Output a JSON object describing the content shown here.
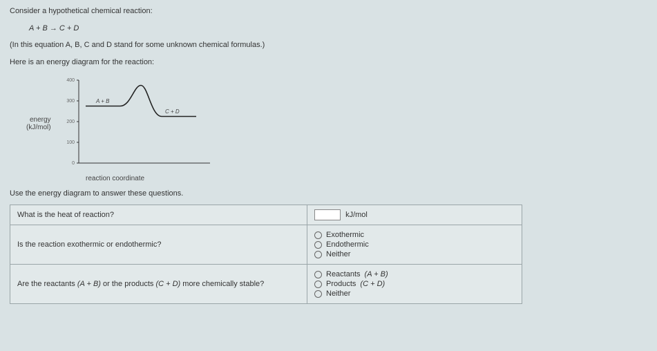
{
  "intro": {
    "line1": "Consider a hypothetical chemical reaction:",
    "equation": "A + B → C + D",
    "line2": "(In this equation A, B, C and D stand for some unknown chemical formulas.)",
    "line3": "Here is an energy diagram for the reaction:"
  },
  "chart_data": {
    "type": "line",
    "xlabel": "reaction coordinate",
    "ylabel_top": "energy",
    "ylabel_bottom": "(kJ/mol)",
    "y_ticks": [
      0,
      100,
      200,
      300,
      400
    ],
    "reactant_label": "A + B",
    "product_label": "C + D",
    "reactant_energy": 275,
    "peak_energy": 375,
    "product_energy": 225,
    "ylim": [
      0,
      400
    ]
  },
  "use_line": "Use the energy diagram to answer these questions.",
  "questions": {
    "q1": {
      "text": "What is the heat of reaction?",
      "unit": "kJ/mol"
    },
    "q2": {
      "text": "Is the reaction exothermic or endothermic?",
      "options": [
        "Exothermic",
        "Endothermic",
        "Neither"
      ]
    },
    "q3": {
      "text_pre": "Are the reactants ",
      "text_reactants": "(A + B)",
      "text_mid": " or the products ",
      "text_products": "(C + D)",
      "text_post": " more chemically stable?",
      "opt1_pre": "Reactants ",
      "opt1_expr": "(A + B)",
      "opt2_pre": "Products ",
      "opt2_expr": "(C + D)",
      "opt3": "Neither"
    }
  }
}
